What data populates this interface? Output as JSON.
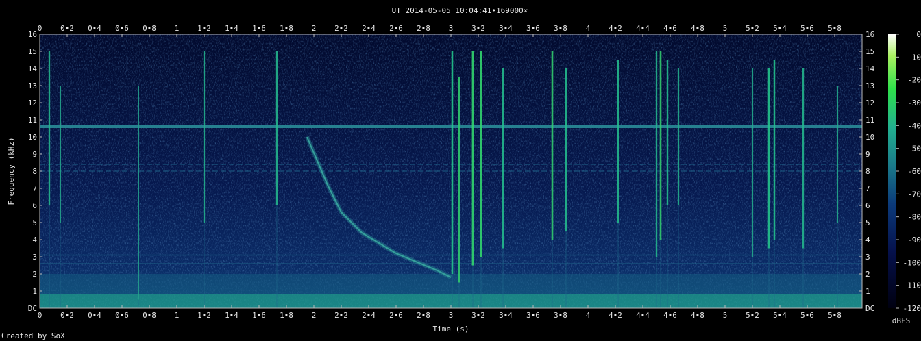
{
  "chart_data": {
    "type": "heatmap",
    "title": "UT 2014-05-05 10:04:41•169000×",
    "xlabel": "Time (s)",
    "ylabel": "Frequency (kHz)",
    "xlim": [
      0,
      5.98
    ],
    "ylim": [
      0,
      16
    ],
    "x_ticks": [
      "0",
      "0•2",
      "0•4",
      "0•6",
      "0•8",
      "1",
      "1•2",
      "1•4",
      "1•6",
      "1•8",
      "2",
      "2•2",
      "2•4",
      "2•6",
      "2•8",
      "3",
      "3•2",
      "3•4",
      "3•6",
      "3•8",
      "4",
      "4•2",
      "4•4",
      "4•6",
      "4•8",
      "5",
      "5•2",
      "5•4",
      "5•6",
      "5•8"
    ],
    "y_ticks": [
      "DC",
      "1",
      "2",
      "3",
      "4",
      "5",
      "6",
      "7",
      "8",
      "9",
      "10",
      "11",
      "12",
      "13",
      "14",
      "15",
      "16"
    ],
    "colorbar": {
      "label": "dBFS",
      "ticks": [
        "0",
        "-10",
        "-20",
        "-30",
        "-40",
        "-50",
        "-60",
        "-70",
        "-80",
        "-90",
        "-100",
        "-110",
        "-120"
      ],
      "range": [
        -120,
        0
      ],
      "colors": [
        "#000010",
        "#05104a",
        "#0b3a7a",
        "#1a7a8a",
        "#22b090",
        "#2ee04a",
        "#a8f060",
        "#ffffff"
      ]
    },
    "features": {
      "horizontal_lines_khz": [
        10.6,
        8.4,
        8.0,
        3.1,
        2.6
      ],
      "low_band_khz": [
        0,
        0.8
      ],
      "whistler_curve": [
        [
          1.95,
          10.0
        ],
        [
          2.1,
          7.2
        ],
        [
          2.2,
          5.6
        ],
        [
          2.35,
          4.4
        ],
        [
          2.6,
          3.2
        ],
        [
          2.9,
          2.2
        ],
        [
          3.0,
          1.8
        ]
      ],
      "impulses": [
        {
          "t": 0.07,
          "f_top": 15.0,
          "f_bot": 6.0,
          "i": 0.55
        },
        {
          "t": 0.15,
          "f_top": 13.0,
          "f_bot": 5.0,
          "i": 0.4
        },
        {
          "t": 0.72,
          "f_top": 13.0,
          "f_bot": 0.5,
          "i": 0.35
        },
        {
          "t": 1.2,
          "f_top": 15.0,
          "f_bot": 5.0,
          "i": 0.5
        },
        {
          "t": 1.73,
          "f_top": 15.0,
          "f_bot": 6.0,
          "i": 0.55
        },
        {
          "t": 3.01,
          "f_top": 15.0,
          "f_bot": 2.0,
          "i": 0.7
        },
        {
          "t": 3.06,
          "f_top": 13.5,
          "f_bot": 1.5,
          "i": 0.75
        },
        {
          "t": 3.16,
          "f_top": 15.0,
          "f_bot": 2.5,
          "i": 0.85
        },
        {
          "t": 3.22,
          "f_top": 15.0,
          "f_bot": 3.0,
          "i": 0.85
        },
        {
          "t": 3.38,
          "f_top": 14.0,
          "f_bot": 3.5,
          "i": 0.6
        },
        {
          "t": 3.74,
          "f_top": 15.0,
          "f_bot": 4.0,
          "i": 0.75
        },
        {
          "t": 3.84,
          "f_top": 14.0,
          "f_bot": 4.5,
          "i": 0.6
        },
        {
          "t": 4.22,
          "f_top": 14.5,
          "f_bot": 5.0,
          "i": 0.6
        },
        {
          "t": 4.5,
          "f_top": 15.0,
          "f_bot": 3.0,
          "i": 0.55
        },
        {
          "t": 4.53,
          "f_top": 15.0,
          "f_bot": 4.0,
          "i": 0.75
        },
        {
          "t": 4.58,
          "f_top": 14.5,
          "f_bot": 6.0,
          "i": 0.6
        },
        {
          "t": 4.66,
          "f_top": 14.0,
          "f_bot": 6.0,
          "i": 0.5
        },
        {
          "t": 5.2,
          "f_top": 14.0,
          "f_bot": 3.0,
          "i": 0.45
        },
        {
          "t": 5.32,
          "f_top": 14.0,
          "f_bot": 3.5,
          "i": 0.7
        },
        {
          "t": 5.36,
          "f_top": 14.5,
          "f_bot": 4.0,
          "i": 0.65
        },
        {
          "t": 5.57,
          "f_top": 14.0,
          "f_bot": 3.5,
          "i": 0.55
        },
        {
          "t": 5.82,
          "f_top": 13.0,
          "f_bot": 5.0,
          "i": 0.45
        }
      ]
    }
  },
  "footer": {
    "credit": "Created by SoX"
  }
}
